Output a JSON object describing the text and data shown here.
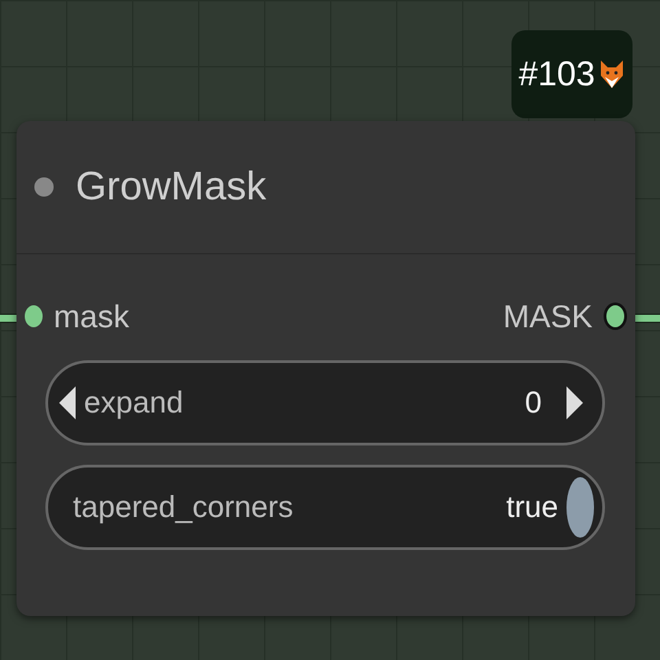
{
  "badge": {
    "text": "#103"
  },
  "node": {
    "title": "GrowMask",
    "inputs": [
      {
        "label": "mask",
        "color": "#7ecb8a"
      }
    ],
    "outputs": [
      {
        "label": "MASK",
        "color": "#7ecb8a"
      }
    ],
    "widgets": [
      {
        "kind": "number",
        "label": "expand",
        "value": "0"
      },
      {
        "kind": "toggle",
        "label": "tapered_corners",
        "value": "true",
        "on": true
      }
    ]
  }
}
